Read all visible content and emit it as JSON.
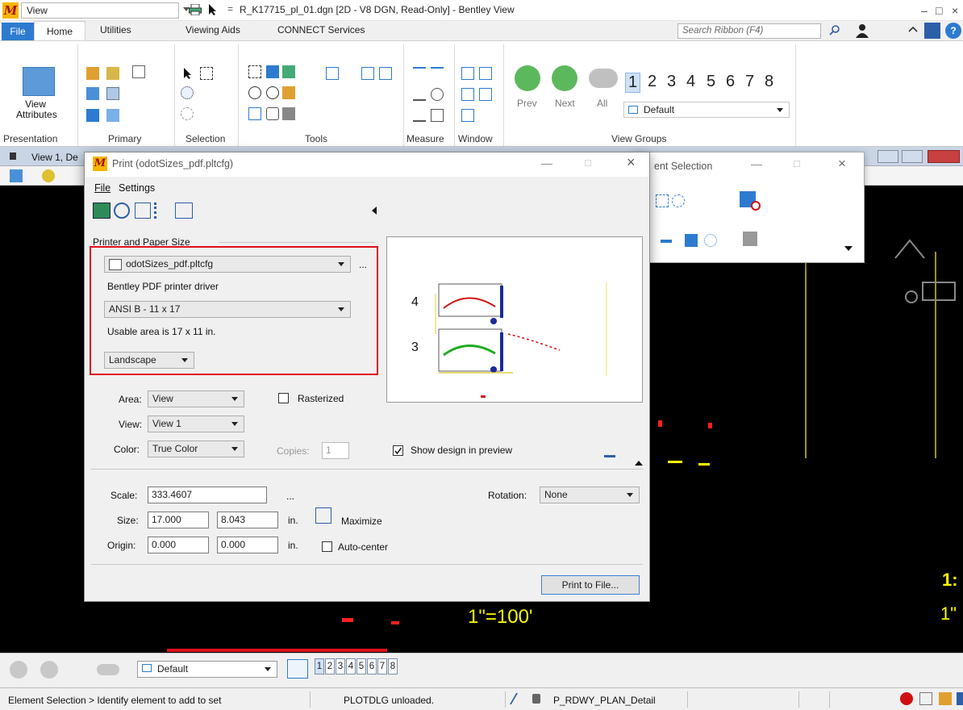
{
  "titlebar": {
    "workspace": "View",
    "title": "R_K17715_pl_01.dgn [2D - V8 DGN, Read-Only] - Bentley View",
    "min": "–",
    "max": "□",
    "close": "×"
  },
  "tabs": {
    "file": "File",
    "home": "Home",
    "utilities": "Utilities",
    "viewing_aids": "Viewing Aids",
    "connect": "CONNECT Services",
    "search_placeholder": "Search Ribbon (F4)"
  },
  "ribbon": {
    "view_attributes": "View Attributes",
    "view_attributes_l1": "View",
    "view_attributes_l2": "Attributes",
    "groups": [
      "Presentation",
      "Primary",
      "Selection",
      "Tools",
      "Measure",
      "Window",
      "View Groups"
    ],
    "prev": "Prev",
    "next": "Next",
    "all": "All",
    "view_numbers": [
      "1",
      "2",
      "3",
      "4",
      "5",
      "6",
      "7",
      "8"
    ],
    "view_group_default": "Default"
  },
  "view": {
    "title": "View 1, De",
    "scale_label_1": "1\"=100'",
    "scale_label_2": "1:",
    "scale_label_3": "1\""
  },
  "element_selection": {
    "title": "ent Selection"
  },
  "print": {
    "title": "Print (odotSizes_pdf.pltcfg)",
    "menu": [
      "File",
      "Settings"
    ],
    "printer_paper_label": "Printer and Paper Size",
    "printer_config": "odotSizes_pdf.pltcfg",
    "more": "...",
    "driver": "Bentley PDF printer driver",
    "paper": "ANSI B - 11 x 17",
    "usable_area": "Usable area is 17 x 11 in.",
    "orientation": "Landscape",
    "area_label": "Area:",
    "area_value": "View",
    "rasterized": "Rasterized",
    "view_label": "View:",
    "view_value": "View 1",
    "color_label": "Color:",
    "color_value": "True Color",
    "copies_label": "Copies:",
    "copies_value": "1",
    "show_design": "Show design in preview",
    "show_design_checked": true,
    "scale_label": "Scale:",
    "scale_value": "333.4607",
    "scale_more": "...",
    "rotation_label": "Rotation:",
    "rotation_value": "None",
    "size_label": "Size:",
    "size_w": "17.000",
    "size_h": "8.043",
    "unit": "in.",
    "maximize": "Maximize",
    "origin_label": "Origin:",
    "origin_x": "0.000",
    "origin_y": "0.000",
    "auto_center": "Auto-center",
    "print_to_file": "Print to File...",
    "preview_label_4": "4",
    "preview_label_3": "3"
  },
  "viewgroups_bar": {
    "default": "Default",
    "views": [
      "1",
      "2",
      "3",
      "4",
      "5",
      "6",
      "7",
      "8"
    ]
  },
  "status": {
    "prompt": "Element Selection > Identify element to add to set",
    "message": "PLOTDLG unloaded.",
    "level": "P_RDWY_PLAN_Detail"
  },
  "colors": {
    "accent": "#2d7bd0",
    "highlight_red": "#e0101a",
    "workspace_bg": "#000000",
    "design_yellow": "#ffff00"
  }
}
